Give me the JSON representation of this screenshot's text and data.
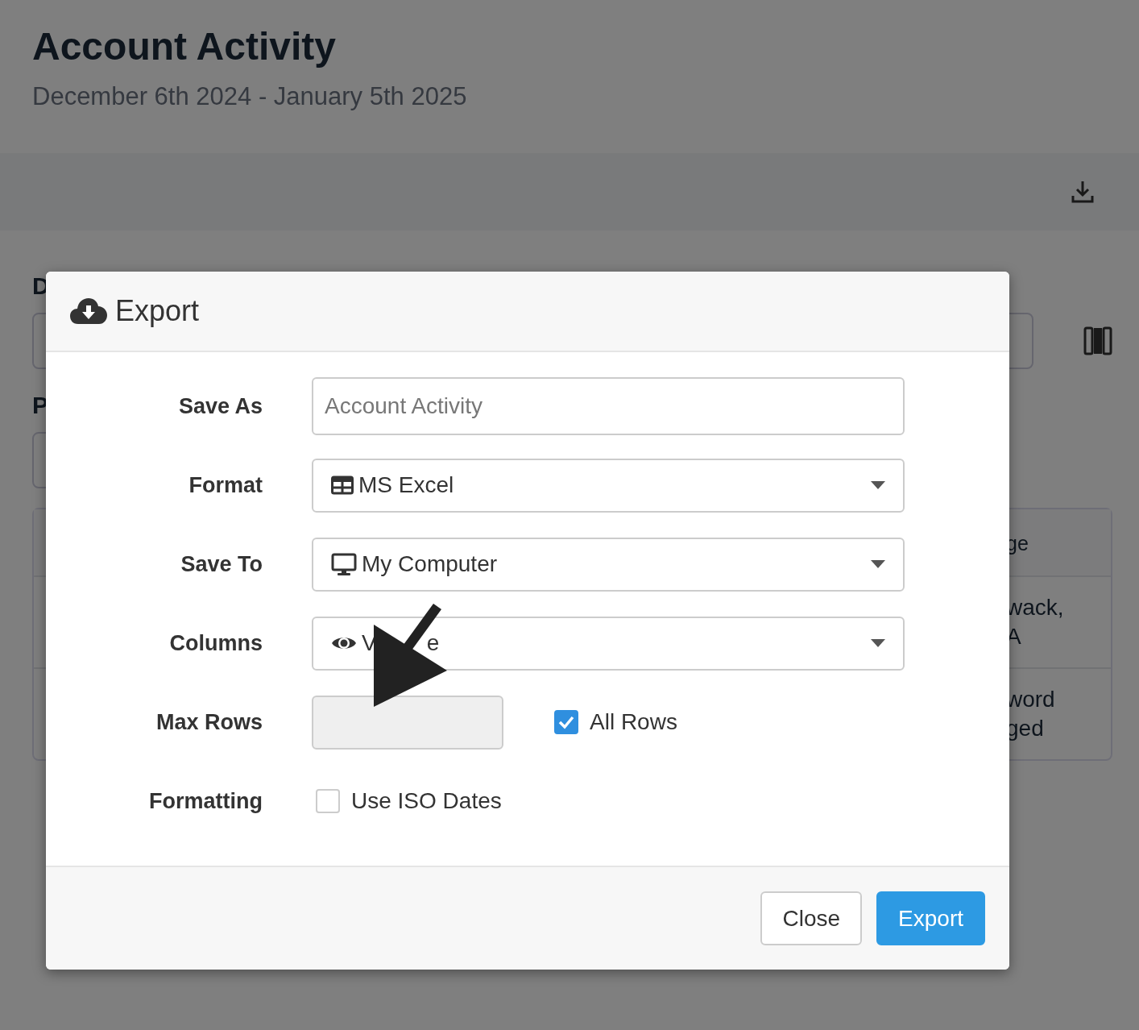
{
  "page": {
    "title": "Account Activity",
    "subtitle": "December 6th 2024 - January 5th 2025",
    "filter_labels": [
      "D",
      "P"
    ],
    "table": {
      "header": "ge",
      "rows": [
        [
          "wack,",
          "A"
        ],
        [
          "word",
          "ged"
        ]
      ]
    }
  },
  "dialog": {
    "title": "Export",
    "fields": [
      {
        "label": "Save As",
        "kind": "text",
        "placeholder": "Account Activity"
      },
      {
        "label": "Format",
        "kind": "select",
        "value": "MS Excel"
      },
      {
        "label": "Save To",
        "kind": "select",
        "value": "My Computer"
      },
      {
        "label": "Columns",
        "kind": "select",
        "value_parts": [
          "V",
          "e"
        ]
      },
      {
        "label": "Max Rows",
        "kind": "number",
        "disabled": true,
        "checkbox": {
          "label": "All Rows",
          "checked": true
        }
      },
      {
        "label": "Formatting",
        "kind": "checkbox",
        "checkbox": {
          "label": "Use ISO Dates",
          "checked": false
        }
      }
    ],
    "buttons": [
      {
        "label": "Close",
        "kind": "secondary"
      },
      {
        "label": "Export",
        "kind": "primary"
      }
    ]
  }
}
